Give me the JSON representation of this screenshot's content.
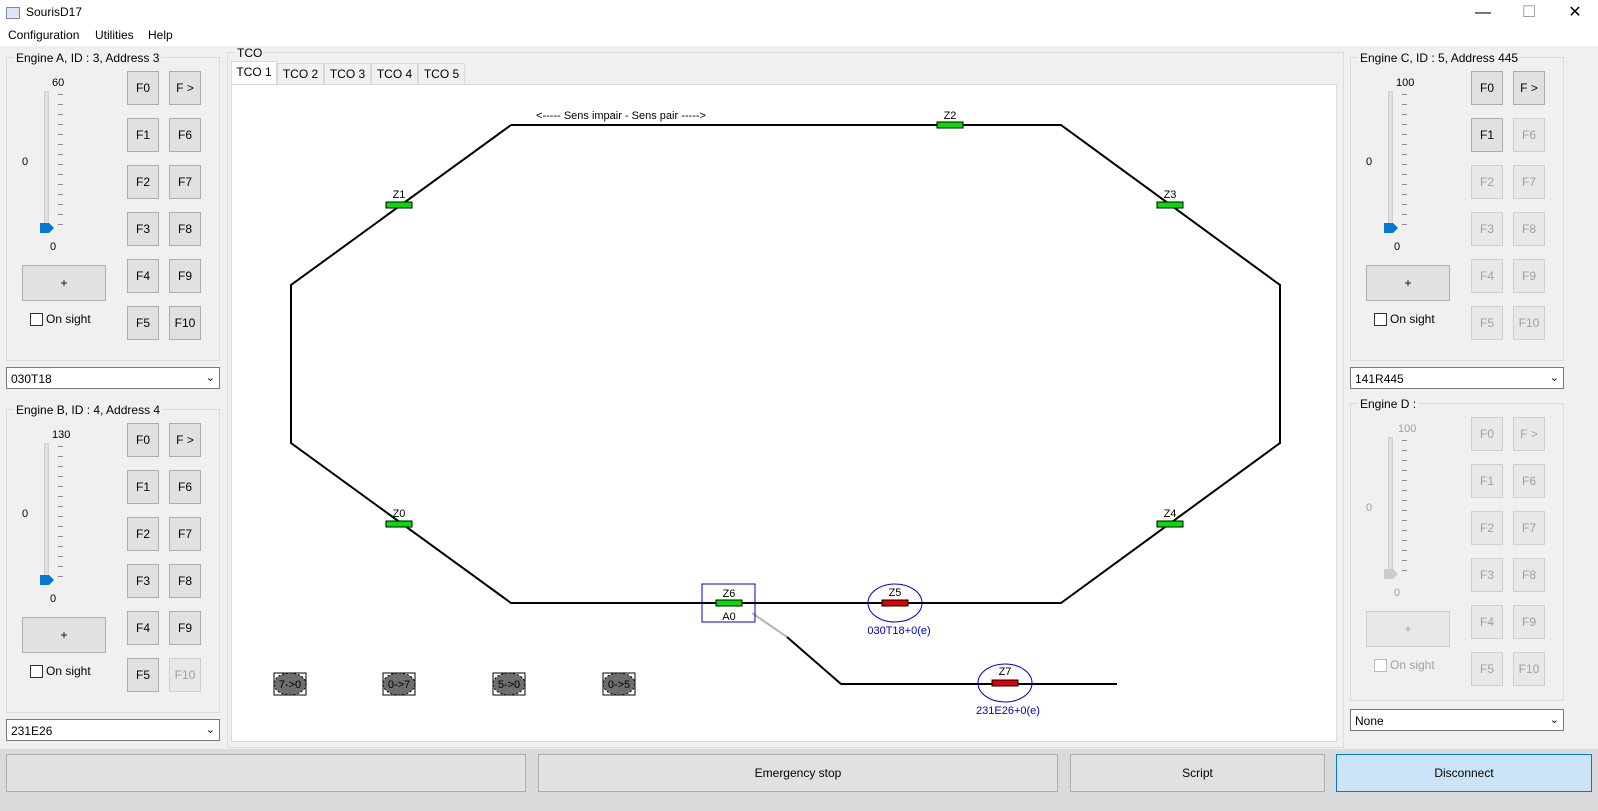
{
  "window": {
    "title": "SourisD17",
    "minimize_glyph": "—",
    "maximize_glyph": "☐",
    "close_glyph": "✕"
  },
  "menu": [
    "Configuration",
    "Utilities",
    "Help"
  ],
  "engine_a": {
    "title": "Engine A, ID : 3, Address 3",
    "slider_max_label": "60",
    "slider_mid_label": "0",
    "slider_min_label": "0",
    "slider_fraction": 0,
    "plus_label": "+",
    "on_sight_label": "On sight",
    "functions": [
      "F0",
      "F >",
      "F1",
      "F6",
      "F2",
      "F7",
      "F3",
      "F8",
      "F4",
      "F9",
      "F5",
      "F10"
    ],
    "disabled_functions": [],
    "select_value": "030T18"
  },
  "engine_b": {
    "title": "Engine B, ID : 4, Address 4",
    "slider_max_label": "130",
    "slider_mid_label": "0",
    "slider_min_label": "0",
    "slider_fraction": 0,
    "plus_label": "+",
    "on_sight_label": "On sight",
    "functions": [
      "F0",
      "F >",
      "F1",
      "F6",
      "F2",
      "F7",
      "F3",
      "F8",
      "F4",
      "F9",
      "F5",
      "F10"
    ],
    "disabled_functions": [
      "F10"
    ],
    "select_value": "231E26"
  },
  "engine_c": {
    "title": "Engine C, ID : 5, Address 445",
    "slider_max_label": "100",
    "slider_mid_label": "0",
    "slider_min_label": "0",
    "slider_fraction": 0,
    "plus_label": "+",
    "on_sight_label": "On sight",
    "functions": [
      "F0",
      "F >",
      "F1",
      "F6",
      "F2",
      "F7",
      "F3",
      "F8",
      "F4",
      "F9",
      "F5",
      "F10"
    ],
    "disabled_functions": [
      "F6",
      "F2",
      "F7",
      "F3",
      "F8",
      "F4",
      "F9",
      "F5",
      "F10"
    ],
    "select_value": "141R445"
  },
  "engine_d": {
    "title": "Engine D :",
    "slider_max_label": "100",
    "slider_mid_label": "0",
    "slider_min_label": "0",
    "slider_fraction": 0,
    "plus_label": "+",
    "on_sight_label": "On sight",
    "functions": [
      "F0",
      "F >",
      "F1",
      "F6",
      "F2",
      "F7",
      "F3",
      "F8",
      "F4",
      "F9",
      "F5",
      "F10"
    ],
    "disabled_functions": [
      "F0",
      "F >",
      "F1",
      "F6",
      "F2",
      "F7",
      "F3",
      "F8",
      "F4",
      "F9",
      "F5",
      "F10"
    ],
    "select_value": "None"
  },
  "tco": {
    "group_title": "TCO",
    "tabs": [
      "TCO 1",
      "TCO 2",
      "TCO 3",
      "TCO 4",
      "TCO 5"
    ],
    "active_tab": "TCO 1",
    "direction_label": "<----- Sens impair - Sens pair ----->",
    "zones": [
      "Z0",
      "Z1",
      "Z2",
      "Z3",
      "Z4",
      "Z5",
      "Z6",
      "Z7"
    ],
    "switch_label": "A0",
    "train_labels": [
      "030T18+0(e)",
      "231E26+0(e)"
    ],
    "routes": [
      "7->0",
      "0->7",
      "5->0",
      "0->5"
    ],
    "colors": {
      "free": "#00e000",
      "occupied": "#e00000",
      "selection": "#0000d0",
      "route": "#6e6e6e"
    }
  },
  "bottom": {
    "status_text": "",
    "emergency_label": "Emergency stop",
    "script_label": "Script",
    "disconnect_label": "Disconnect"
  }
}
